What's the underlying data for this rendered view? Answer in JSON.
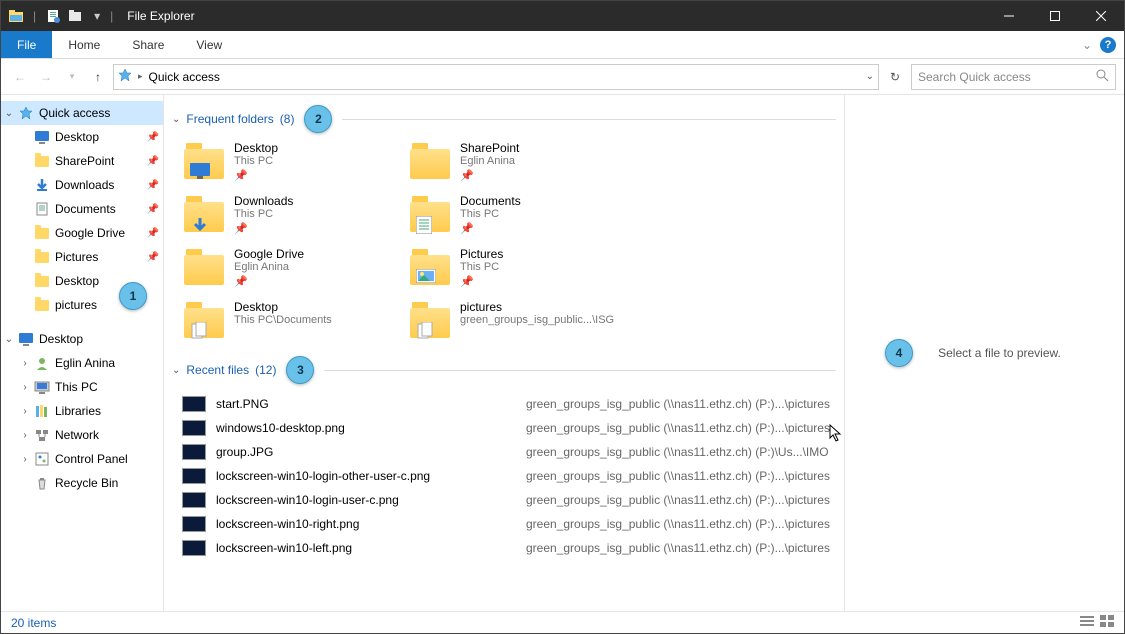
{
  "title": "File Explorer",
  "ribbon": {
    "file": "File",
    "tabs": [
      "Home",
      "Share",
      "View"
    ]
  },
  "address": {
    "location": "Quick access",
    "search_placeholder": "Search Quick access"
  },
  "tree": {
    "quick_access": "Quick access",
    "qa_items": [
      {
        "label": "Desktop",
        "icon": "desktop"
      },
      {
        "label": "SharePoint",
        "icon": "folder"
      },
      {
        "label": "Downloads",
        "icon": "download"
      },
      {
        "label": "Documents",
        "icon": "document"
      },
      {
        "label": "Google Drive",
        "icon": "folder"
      },
      {
        "label": "Pictures",
        "icon": "folder"
      },
      {
        "label": "Desktop",
        "icon": "folder"
      },
      {
        "label": "pictures",
        "icon": "folder"
      }
    ],
    "desktop": "Desktop",
    "d_items": [
      {
        "label": "Eglin  Anina",
        "icon": "user"
      },
      {
        "label": "This PC",
        "icon": "pc"
      },
      {
        "label": "Libraries",
        "icon": "libraries"
      },
      {
        "label": "Network",
        "icon": "network"
      },
      {
        "label": "Control Panel",
        "icon": "control"
      },
      {
        "label": "Recycle Bin",
        "icon": "recycle"
      }
    ]
  },
  "groups": {
    "frequent": {
      "label": "Frequent folders",
      "count": "(8)"
    },
    "recent": {
      "label": "Recent files",
      "count": "(12)"
    }
  },
  "folders": [
    {
      "name": "Desktop",
      "sub": "This PC",
      "overlay": "desktop",
      "pin": true
    },
    {
      "name": "SharePoint",
      "sub": "Eglin  Anina",
      "overlay": "",
      "pin": true
    },
    {
      "name": "Downloads",
      "sub": "This PC",
      "overlay": "download",
      "pin": true
    },
    {
      "name": "Documents",
      "sub": "This PC",
      "overlay": "document",
      "pin": true
    },
    {
      "name": "Google Drive",
      "sub": "Eglin  Anina",
      "overlay": "",
      "pin": true
    },
    {
      "name": "Pictures",
      "sub": "This PC",
      "overlay": "picture",
      "pin": true
    },
    {
      "name": "Desktop",
      "sub": "This PC\\Documents",
      "overlay": "files",
      "pin": false
    },
    {
      "name": "pictures",
      "sub": "green_groups_isg_public...\\ISG",
      "overlay": "files",
      "pin": false
    }
  ],
  "recent": [
    {
      "name": "start.PNG",
      "path": "green_groups_isg_public (\\\\nas11.ethz.ch) (P:)...\\pictures"
    },
    {
      "name": "windows10-desktop.png",
      "path": "green_groups_isg_public (\\\\nas11.ethz.ch) (P:)...\\pictures"
    },
    {
      "name": "group.JPG",
      "path": "green_groups_isg_public (\\\\nas11.ethz.ch) (P:)\\Us...\\IMO"
    },
    {
      "name": "lockscreen-win10-login-other-user-c.png",
      "path": "green_groups_isg_public (\\\\nas11.ethz.ch) (P:)...\\pictures"
    },
    {
      "name": "lockscreen-win10-login-user-c.png",
      "path": "green_groups_isg_public (\\\\nas11.ethz.ch) (P:)...\\pictures"
    },
    {
      "name": "lockscreen-win10-right.png",
      "path": "green_groups_isg_public (\\\\nas11.ethz.ch) (P:)...\\pictures"
    },
    {
      "name": "lockscreen-win10-left.png",
      "path": "green_groups_isg_public (\\\\nas11.ethz.ch) (P:)...\\pictures"
    }
  ],
  "preview_text": "Select a file to preview.",
  "status": "20 items",
  "annotations": [
    "1",
    "2",
    "3",
    "4"
  ]
}
